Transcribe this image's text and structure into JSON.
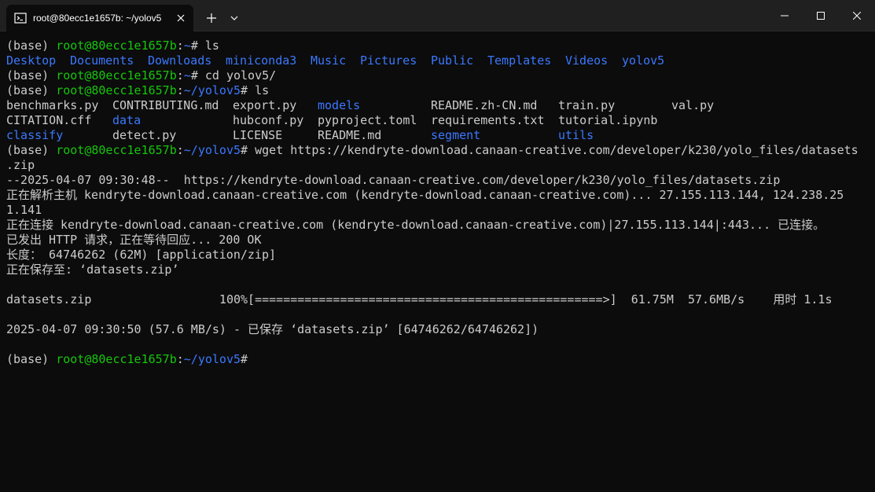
{
  "window": {
    "tab_title": "root@80ecc1e1657b: ~/yolov5",
    "tab_icon": "terminal-icon",
    "new_tab_icon": "plus-icon",
    "dropdown_icon": "chevron-down-icon",
    "minimize_icon": "minimize-icon",
    "maximize_icon": "maximize-icon",
    "close_icon": "close-icon"
  },
  "colors": {
    "background": "#0c0c0c",
    "text": "#cccccc",
    "prompt_user": "#16c60c",
    "prompt_path": "#3b78ff",
    "directory": "#3b78ff",
    "titlebar": "#202020"
  },
  "prompt": {
    "env": "(base) ",
    "user_host": "root@80ecc1e1657b",
    "colon": ":",
    "home": "~",
    "yolov5": "~/yolov5",
    "hash": "# "
  },
  "commands": {
    "ls1": "ls",
    "cd": "cd yolov5/",
    "ls2": "ls",
    "wget": "wget https://kendryte-download.canaan-creative.com/developer/k230/yolo_files/datasets",
    "wget_wrap": ".zip"
  },
  "home_listing": [
    "Desktop",
    "Documents",
    "Downloads",
    "miniconda3",
    "Music",
    "Pictures",
    "Public",
    "Templates",
    "Videos",
    "yolov5"
  ],
  "yolov5_listing": {
    "row1": [
      "benchmarks.py",
      "CONTRIBUTING.md",
      "export.py",
      "models",
      "README.zh-CN.md",
      "train.py",
      "val.py"
    ],
    "row2": [
      "CITATION.cff",
      "data",
      "hubconf.py",
      "pyproject.toml",
      "requirements.txt",
      "tutorial.ipynb"
    ],
    "row3": [
      "classify",
      "detect.py",
      "LICENSE",
      "README.md",
      "segment",
      "utils"
    ]
  },
  "wget_output": {
    "start": "--2025-04-07 09:30:48--  https://kendryte-download.canaan-creative.com/developer/k230/yolo_files/datasets.zip",
    "resolving": "正在解析主机 kendryte-download.canaan-creative.com (kendryte-download.canaan-creative.com)... 27.155.113.144, 124.238.25",
    "resolving_wrap": "1.141",
    "connecting": "正在连接 kendryte-download.canaan-creative.com (kendryte-download.canaan-creative.com)|27.155.113.144|:443... 已连接。",
    "http": "已发出 HTTP 请求，正在等待回应... 200 OK",
    "length": "长度： 64746262 (62M) [application/zip]",
    "saving": "正在保存至: ‘datasets.zip’",
    "progress": "datasets.zip                  100%[=================================================>]  61.75M  57.6MB/s    用时 1.1s",
    "saved": "2025-04-07 09:30:50 (57.6 MB/s) - 已保存 ‘datasets.zip’ [64746262/64746262])"
  }
}
